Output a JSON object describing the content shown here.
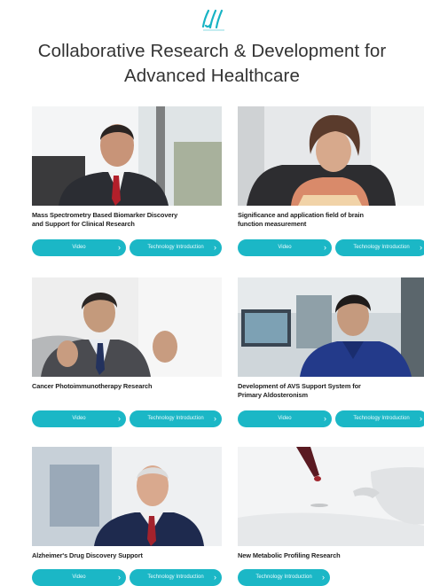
{
  "header": {
    "logo_icon": "brand-logo-icon",
    "title_line1": "Collaborative Research & Development for",
    "title_line2": "Advanced Healthcare"
  },
  "buttons": {
    "video_label": "Video",
    "tech_label": "Technology Introduction"
  },
  "colors": {
    "accent": "#1bb7c6",
    "logo": "#17b3c4"
  },
  "cards": [
    {
      "title_lines": [
        "Mass Spectrometry Based Biomarker Discovery",
        "and Support for Clinical Research"
      ]
    },
    {
      "title_lines": [
        "Significance and application field of brain",
        "function measurement"
      ]
    },
    {
      "title_lines": [
        "Cancer Photoimmunotherapy Research",
        ""
      ]
    },
    {
      "title_lines": [
        "Development of AVS Support System for",
        "Primary Aldosteronism"
      ]
    },
    {
      "title_lines": [
        "Alzheimer's Drug Discovery Support",
        ""
      ]
    },
    {
      "title_lines": [
        "New Metabolic Profiling Research",
        ""
      ]
    }
  ]
}
